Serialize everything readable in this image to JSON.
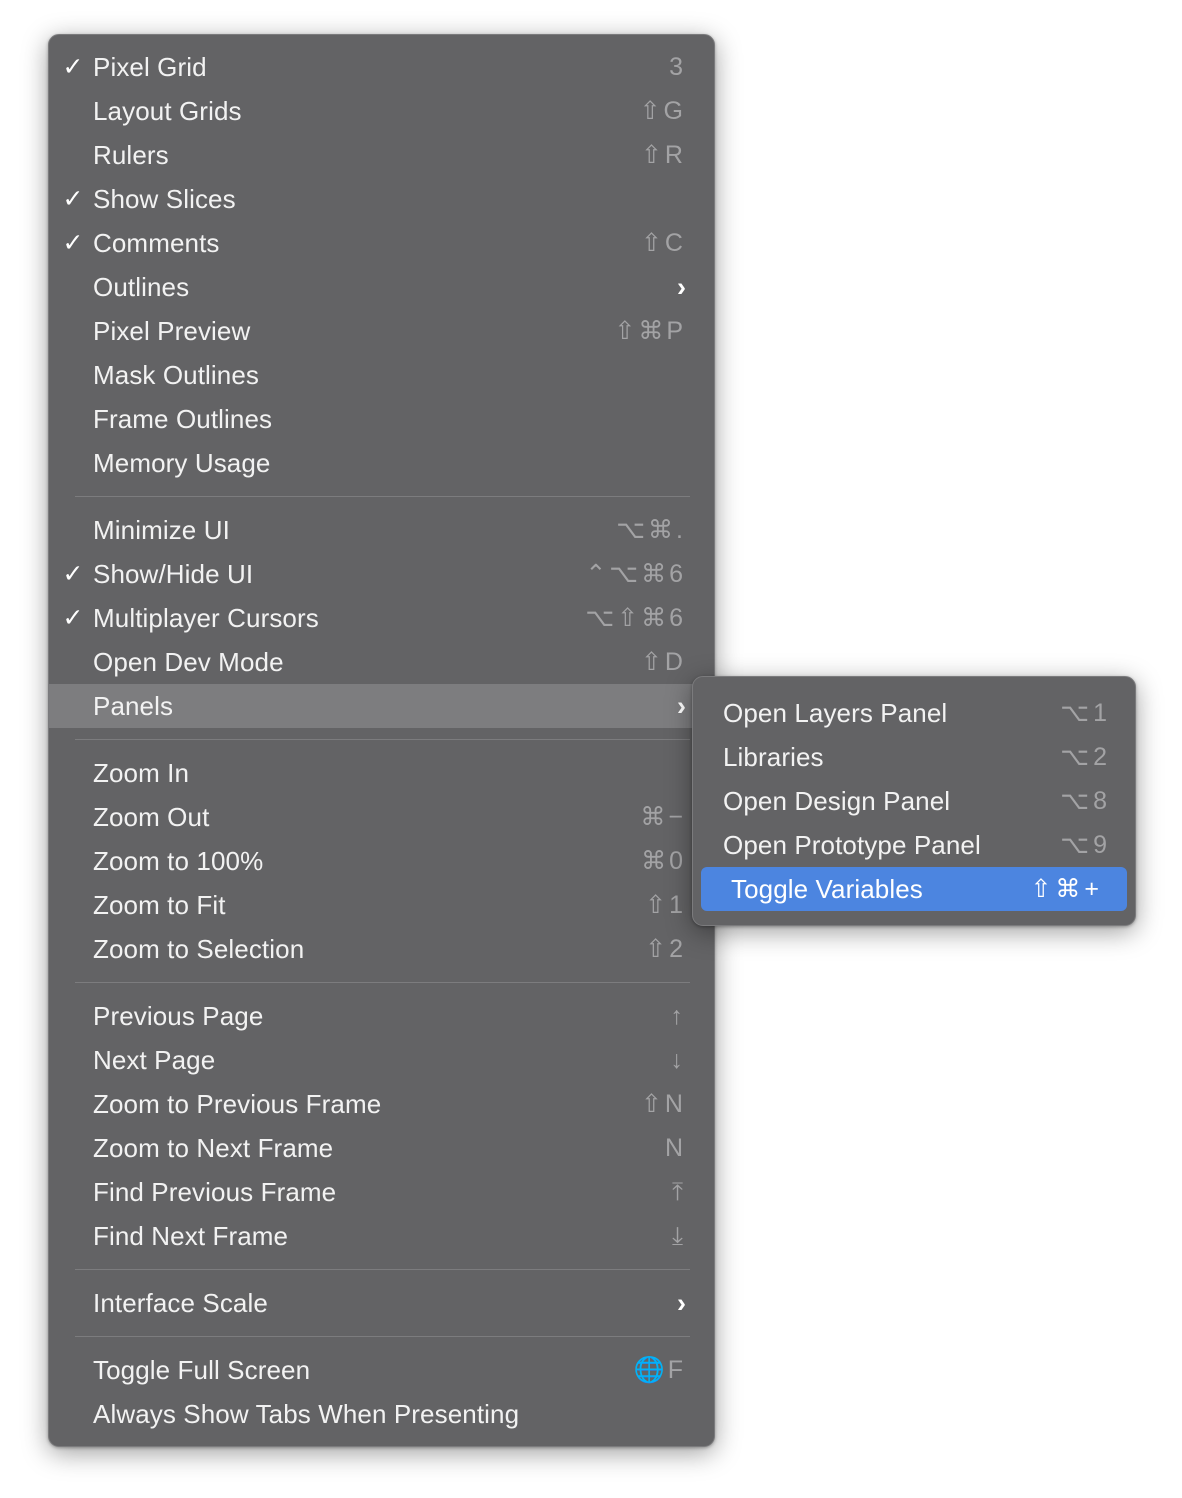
{
  "colors": {
    "menu_background": "#636365",
    "menu_border": "#7b7b7d",
    "label_text": "#f2f2f2",
    "shortcut_text": "#a3a3a5",
    "highlight_gray": "#7d7d7f",
    "highlight_blue": "#4c85e0",
    "separator": "#7c7c7e",
    "page_background": "#ffffff"
  },
  "icons": {
    "checkmark": "✓",
    "submenu_chevron": "›",
    "shift_key": "⇧",
    "command_key": "⌘",
    "option_key": "⌥",
    "control_key": "⌃",
    "globe_key": "🌐",
    "arrow_up": "↑",
    "arrow_down": "↓",
    "arrow_up_to_bar": "⤒",
    "arrow_down_to_bar": "⤓"
  },
  "main_menu": {
    "name": "view-menu",
    "groups": [
      {
        "name": "display-toggles-group",
        "items": [
          {
            "label": "Pixel Grid",
            "shortcut": "3",
            "checked": true,
            "submenu": false,
            "state": "normal"
          },
          {
            "label": "Layout Grids",
            "shortcut": "⇧G",
            "checked": false,
            "submenu": false,
            "state": "normal"
          },
          {
            "label": "Rulers",
            "shortcut": "⇧R",
            "checked": false,
            "submenu": false,
            "state": "normal"
          },
          {
            "label": "Show Slices",
            "shortcut": "",
            "checked": true,
            "submenu": false,
            "state": "normal"
          },
          {
            "label": "Comments",
            "shortcut": "⇧C",
            "checked": true,
            "submenu": false,
            "state": "normal"
          },
          {
            "label": "Outlines",
            "shortcut": "",
            "checked": false,
            "submenu": true,
            "state": "normal"
          },
          {
            "label": "Pixel Preview",
            "shortcut": "⇧⌘P",
            "checked": false,
            "submenu": false,
            "state": "normal"
          },
          {
            "label": "Mask Outlines",
            "shortcut": "",
            "checked": false,
            "submenu": false,
            "state": "normal"
          },
          {
            "label": "Frame Outlines",
            "shortcut": "",
            "checked": false,
            "submenu": false,
            "state": "normal"
          },
          {
            "label": "Memory Usage",
            "shortcut": "",
            "checked": false,
            "submenu": false,
            "state": "normal"
          }
        ]
      },
      {
        "name": "ui-and-panels-group",
        "items": [
          {
            "label": "Minimize UI",
            "shortcut": "⌥⌘.",
            "checked": false,
            "submenu": false,
            "state": "normal"
          },
          {
            "label": "Show/Hide UI",
            "shortcut": "⌃⌥⌘6",
            "checked": true,
            "submenu": false,
            "state": "normal"
          },
          {
            "label": "Multiplayer Cursors",
            "shortcut": "⌥⇧⌘6",
            "checked": true,
            "submenu": false,
            "state": "normal"
          },
          {
            "label": "Open Dev Mode",
            "shortcut": "⇧D",
            "checked": false,
            "submenu": false,
            "state": "normal"
          },
          {
            "label": "Panels",
            "shortcut": "",
            "checked": false,
            "submenu": true,
            "state": "highlighted-gray"
          }
        ]
      },
      {
        "name": "zoom-group",
        "items": [
          {
            "label": "Zoom In",
            "shortcut": "",
            "checked": false,
            "submenu": false,
            "state": "normal"
          },
          {
            "label": "Zoom Out",
            "shortcut": "⌘−",
            "checked": false,
            "submenu": false,
            "state": "normal"
          },
          {
            "label": "Zoom to 100%",
            "shortcut": "⌘0",
            "checked": false,
            "submenu": false,
            "state": "normal"
          },
          {
            "label": "Zoom to Fit",
            "shortcut": "⇧1",
            "checked": false,
            "submenu": false,
            "state": "normal"
          },
          {
            "label": "Zoom to Selection",
            "shortcut": "⇧2",
            "checked": false,
            "submenu": false,
            "state": "normal"
          }
        ]
      },
      {
        "name": "navigation-group",
        "items": [
          {
            "label": "Previous Page",
            "shortcut": "↑",
            "checked": false,
            "submenu": false,
            "state": "normal"
          },
          {
            "label": "Next Page",
            "shortcut": "↓",
            "checked": false,
            "submenu": false,
            "state": "normal"
          },
          {
            "label": "Zoom to Previous Frame",
            "shortcut": "⇧N",
            "checked": false,
            "submenu": false,
            "state": "normal"
          },
          {
            "label": "Zoom to Next Frame",
            "shortcut": "N",
            "checked": false,
            "submenu": false,
            "state": "normal"
          },
          {
            "label": "Find Previous Frame",
            "shortcut": "⤒",
            "checked": false,
            "submenu": false,
            "state": "normal"
          },
          {
            "label": "Find Next Frame",
            "shortcut": "⤓",
            "checked": false,
            "submenu": false,
            "state": "normal"
          }
        ]
      },
      {
        "name": "interface-scale-group",
        "items": [
          {
            "label": "Interface Scale",
            "shortcut": "",
            "checked": false,
            "submenu": true,
            "state": "normal"
          }
        ]
      },
      {
        "name": "fullscreen-group",
        "items": [
          {
            "label": "Toggle Full Screen",
            "shortcut": "🌐F",
            "checked": false,
            "submenu": false,
            "state": "normal"
          },
          {
            "label": "Always Show Tabs When Presenting",
            "shortcut": "",
            "checked": false,
            "submenu": false,
            "state": "normal"
          }
        ]
      }
    ]
  },
  "submenu": {
    "name": "panels-submenu",
    "parent_item": "Panels",
    "groups": [
      {
        "name": "panels-group",
        "items": [
          {
            "label": "Open Layers Panel",
            "shortcut": "⌥1",
            "checked": false,
            "submenu": false,
            "state": "normal"
          },
          {
            "label": "Libraries",
            "shortcut": "⌥2",
            "checked": false,
            "submenu": false,
            "state": "normal"
          },
          {
            "label": "Open Design Panel",
            "shortcut": "⌥8",
            "checked": false,
            "submenu": false,
            "state": "normal"
          },
          {
            "label": "Open Prototype Panel",
            "shortcut": "⌥9",
            "checked": false,
            "submenu": false,
            "state": "normal"
          },
          {
            "label": "Toggle Variables",
            "shortcut": "⇧⌘+",
            "checked": false,
            "submenu": false,
            "state": "highlighted-blue"
          }
        ]
      }
    ]
  }
}
